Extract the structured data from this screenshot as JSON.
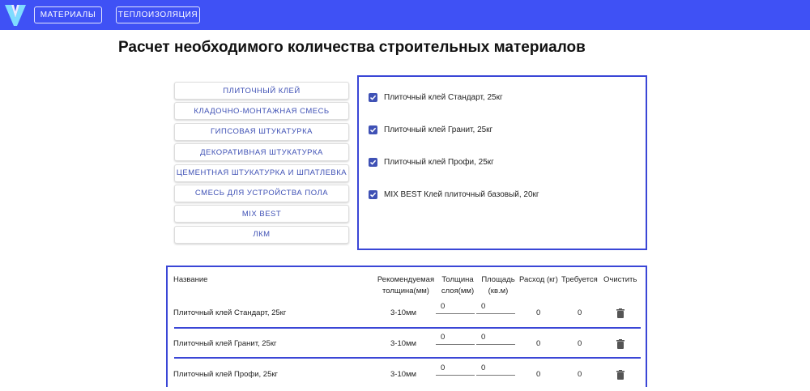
{
  "nav": {
    "materials": "Материалы",
    "insulation": "Теплоизоляция"
  },
  "title": "Расчет необходимого количества строительных материалов",
  "categories": [
    "Плиточный клей",
    "Кладочно-монтажная смесь",
    "Гипсовая штукатурка",
    "Декоративная штукатурка",
    "Цементная штукатурка и шпатлевка",
    "Смесь для устройства пола",
    "MIX BEST",
    "ЛКМ"
  ],
  "products": [
    {
      "label": "Плиточный клей Стандарт, 25кг",
      "checked": true
    },
    {
      "label": "Плиточный клей Гранит, 25кг",
      "checked": true
    },
    {
      "label": "Плиточный клей Профи, 25кг",
      "checked": true
    },
    {
      "label": "MIX BEST Клей плиточный базовый, 20кг",
      "checked": true
    }
  ],
  "table": {
    "headers": {
      "name": "Название",
      "recommended_1": "Рекомендуемая",
      "recommended_2": "толщина(мм)",
      "thickness_1": "Толщина",
      "thickness_2": "слоя(мм)",
      "area_1": "Площадь",
      "area_2": "(кв.м)",
      "consumption": "Расход (кг)",
      "required": "Требуется",
      "clear": "Очистить"
    },
    "rows": [
      {
        "name": "Плиточный клей Стандарт, 25кг",
        "recommended": "3-10мм",
        "thickness": "0",
        "area": "0",
        "consumption": "0",
        "required": "0"
      },
      {
        "name": "Плиточный клей Гранит, 25кг",
        "recommended": "3-10мм",
        "thickness": "0",
        "area": "0",
        "consumption": "0",
        "required": "0"
      },
      {
        "name": "Плиточный клей Профи, 25кг",
        "recommended": "3-10мм",
        "thickness": "0",
        "area": "0",
        "consumption": "0",
        "required": "0"
      }
    ]
  },
  "colors": {
    "accent": "#3f51f5",
    "panel_border": "#3a46d6",
    "button_text": "#3f51b5"
  },
  "icons": {
    "logo": "logo-v-icon",
    "checkbox": "checkbox-checked-icon",
    "delete": "trash-icon"
  }
}
